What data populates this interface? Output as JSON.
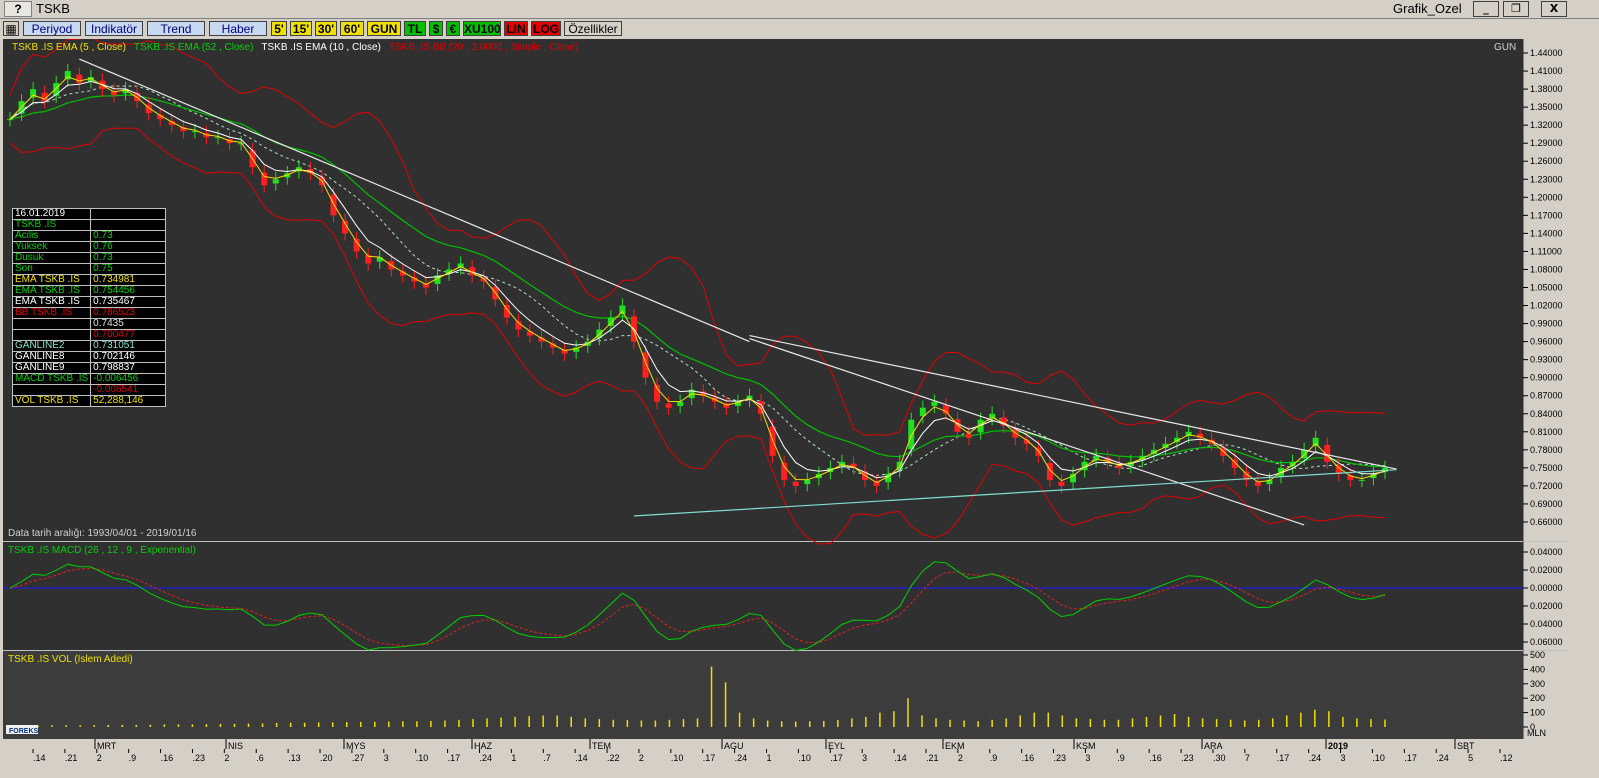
{
  "window": {
    "help_label": "?",
    "title": "TSKB",
    "right_title": "Grafik_Ozel",
    "minimize": "_",
    "restore": "❐",
    "close": "X"
  },
  "toolbar": {
    "buttons": [
      "Periyod",
      "Indikatör",
      "Trend",
      "Haber",
      "5'",
      "15'",
      "30'",
      "60'",
      "GUN",
      "TL",
      "$",
      "€",
      "XU100",
      "LIN",
      "LOG",
      "Özellikler"
    ]
  },
  "price_panel": {
    "legend": [
      {
        "text": "TSKB .IS EMA (5 , Close)",
        "color": "#f0e000"
      },
      {
        "text": "TSKB .IS EMA (52 , Close)",
        "color": "#00d000"
      },
      {
        "text": "TSKB .IS EMA (10 , Close)",
        "color": "#ffffff"
      },
      {
        "text": "TSKB .IS BB (20 , 2.0000 , Simple , Close)",
        "color": "#e00000"
      }
    ],
    "period_label": "GUN",
    "date_range": "Data tarih aralığı: 1993/04/01 - 2019/01/16",
    "y_ticks": [
      "1.44000",
      "1.41000",
      "1.38000",
      "1.35000",
      "1.32000",
      "1.29000",
      "1.26000",
      "1.23000",
      "1.20000",
      "1.17000",
      "1.14000",
      "1.11000",
      "1.08000",
      "1.05000",
      "1.02000",
      "0.99000",
      "0.96000",
      "0.93000",
      "0.90000",
      "0.87000",
      "0.84000",
      "0.81000",
      "0.78000",
      "0.75000",
      "0.72000",
      "0.69000",
      "0.66000"
    ]
  },
  "info_box": {
    "rows": [
      {
        "label": "16.01.2019",
        "value": "",
        "color": "#ffffff"
      },
      {
        "label": "TSKB .IS",
        "value": "",
        "color": "#00d000"
      },
      {
        "label": " Acilis",
        "value": "0.73",
        "color": "#00d000"
      },
      {
        "label": " Yuksek",
        "value": "0.76",
        "color": "#00d000"
      },
      {
        "label": " Dusuk",
        "value": "0.73",
        "color": "#00d000"
      },
      {
        "label": " Son",
        "value": "0.75",
        "color": "#00d000"
      },
      {
        "label": "EMA TSKB .IS",
        "value": "0.734981",
        "color": "#f0e000"
      },
      {
        "label": "EMA TSKB .IS",
        "value": "0.754456",
        "color": "#00d000"
      },
      {
        "label": "EMA TSKB .IS",
        "value": "0.735467",
        "color": "#ffffff"
      },
      {
        "label": "BB TSKB .IS",
        "value": "0.786523",
        "color": "#e00000"
      },
      {
        "label": "",
        "value": "0.7435",
        "color": "#e0e0e0"
      },
      {
        "label": "",
        "value": "0.700477",
        "color": "#e00000"
      },
      {
        "label": "GANLINE2",
        "value": "0.731051",
        "color": "#80e0d0"
      },
      {
        "label": "GANLINE8",
        "value": "0.702146",
        "color": "#ffffff"
      },
      {
        "label": "GANLINE9",
        "value": "0.798837",
        "color": "#ffffff"
      },
      {
        "label": "MACD TSKB .IS",
        "value": "-0.006456",
        "color": "#00d000"
      },
      {
        "label": "",
        "value": "-0.006541",
        "color": "#e00000"
      },
      {
        "label": "VOL TSKB .IS",
        "value": "52,288,146",
        "color": "#f0e000"
      }
    ]
  },
  "macd_panel": {
    "legend": "TSKB .IS MACD (26 , 12 , 9 , Exponential)",
    "y_ticks": [
      "0.04000",
      "0.02000",
      "0.00000",
      "0.02000",
      "0.04000",
      "0.06000"
    ]
  },
  "vol_panel": {
    "legend": "TSKB .IS VOL (Islem Adedi)",
    "y_ticks": [
      "500",
      "400",
      "300",
      "200",
      "100",
      "0"
    ],
    "unit": "MLN",
    "logo_text": "FOREKS"
  },
  "x_axis": {
    "months": [
      "MRT",
      "NIS",
      "MYS",
      "HAZ",
      "TEM",
      "AGU",
      "EYL",
      "EKM",
      "KSM",
      "ARA",
      "2019",
      "SBT"
    ],
    "day_ticks": [
      ".14",
      ".21",
      "2",
      ".9",
      ".16",
      ".23",
      "2",
      ".6",
      ".13",
      ".20",
      ".27",
      "3",
      ".10",
      ".17",
      ".24",
      "1",
      ".7",
      ".14",
      ".22",
      "2",
      ".10",
      ".17",
      ".24",
      "1",
      ".10",
      ".17",
      "3",
      ".14",
      ".21",
      "2",
      ".9",
      ".16",
      ".23",
      "3",
      ".9",
      ".16",
      ".23",
      ".30",
      "7",
      ".17",
      ".24",
      "3",
      ".10",
      ".17",
      ".24",
      "5",
      ".12"
    ]
  },
  "chart_data": {
    "type": "candlestick",
    "symbol": "TSKB .IS",
    "interval": "GUN",
    "ylim": [
      0.645,
      1.45
    ],
    "close_series": [
      1.33,
      1.36,
      1.38,
      1.36,
      1.39,
      1.41,
      1.39,
      1.4,
      1.38,
      1.37,
      1.38,
      1.36,
      1.34,
      1.33,
      1.32,
      1.31,
      1.31,
      1.3,
      1.3,
      1.29,
      1.29,
      1.25,
      1.22,
      1.23,
      1.24,
      1.25,
      1.24,
      1.22,
      1.17,
      1.14,
      1.11,
      1.09,
      1.1,
      1.08,
      1.07,
      1.06,
      1.05,
      1.07,
      1.08,
      1.09,
      1.07,
      1.06,
      1.03,
      1.0,
      0.98,
      0.97,
      0.96,
      0.95,
      0.94,
      0.95,
      0.96,
      0.98,
      1.0,
      1.02,
      0.96,
      0.9,
      0.86,
      0.85,
      0.86,
      0.88,
      0.87,
      0.86,
      0.85,
      0.86,
      0.87,
      0.84,
      0.77,
      0.73,
      0.72,
      0.73,
      0.74,
      0.75,
      0.76,
      0.75,
      0.73,
      0.72,
      0.74,
      0.76,
      0.83,
      0.85,
      0.86,
      0.84,
      0.81,
      0.8,
      0.83,
      0.84,
      0.82,
      0.8,
      0.79,
      0.77,
      0.73,
      0.72,
      0.74,
      0.76,
      0.77,
      0.76,
      0.75,
      0.76,
      0.77,
      0.78,
      0.79,
      0.8,
      0.81,
      0.8,
      0.79,
      0.77,
      0.75,
      0.73,
      0.72,
      0.73,
      0.75,
      0.76,
      0.78,
      0.8,
      0.76,
      0.74,
      0.73,
      0.73,
      0.74,
      0.75
    ],
    "volume_series_mln": [
      10,
      10,
      10,
      12,
      12,
      12,
      13,
      14,
      14,
      15,
      16,
      18,
      18,
      18,
      20,
      22,
      22,
      24,
      25,
      28,
      30,
      30,
      32,
      32,
      34,
      35,
      36,
      38,
      40,
      40,
      42,
      45,
      50,
      55,
      60,
      65,
      70,
      75,
      80,
      80,
      70,
      60,
      55,
      50,
      48,
      45,
      45,
      50,
      55,
      60,
      420,
      310,
      100,
      60,
      45,
      40,
      38,
      40,
      42,
      48,
      60,
      70,
      100,
      110,
      200,
      80,
      60,
      50,
      45,
      40,
      50,
      60,
      80,
      100,
      100,
      80,
      60,
      55,
      50,
      50,
      60,
      70,
      80,
      90,
      70,
      60,
      55,
      50,
      45,
      50,
      60,
      80,
      100,
      120,
      110,
      70,
      60,
      55,
      52
    ],
    "volume_ylim": [
      0,
      500
    ]
  }
}
